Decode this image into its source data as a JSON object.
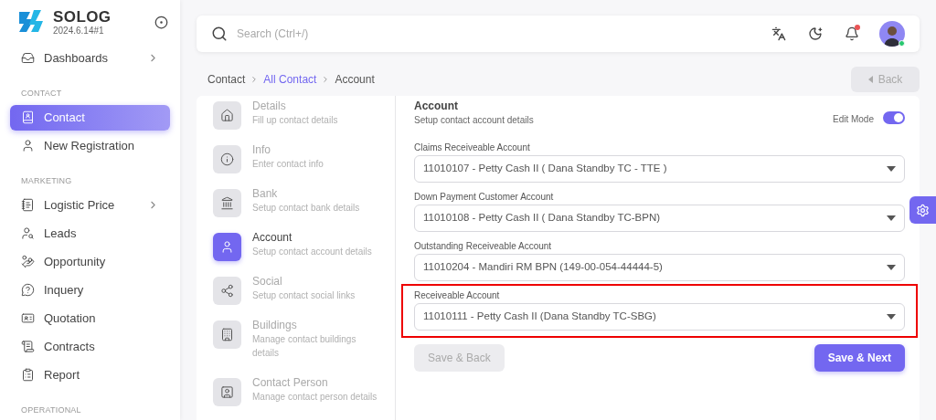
{
  "brand": {
    "name": "SOLOG",
    "version": "2024.6.14#1"
  },
  "sidebar": {
    "items": [
      {
        "kind": "item",
        "label": "Dashboards",
        "selected": false,
        "expandable": true
      },
      {
        "kind": "section",
        "label": "CONTACT"
      },
      {
        "kind": "item",
        "label": "Contact",
        "selected": true,
        "expandable": false
      },
      {
        "kind": "item",
        "label": "New Registration",
        "selected": false,
        "expandable": false
      },
      {
        "kind": "section",
        "label": "MARKETING"
      },
      {
        "kind": "item",
        "label": "Logistic Price",
        "selected": false,
        "expandable": true
      },
      {
        "kind": "item",
        "label": "Leads",
        "selected": false,
        "expandable": false
      },
      {
        "kind": "item",
        "label": "Opportunity",
        "selected": false,
        "expandable": false
      },
      {
        "kind": "item",
        "label": "Inquery",
        "selected": false,
        "expandable": false
      },
      {
        "kind": "item",
        "label": "Quotation",
        "selected": false,
        "expandable": false
      },
      {
        "kind": "item",
        "label": "Contracts",
        "selected": false,
        "expandable": false
      },
      {
        "kind": "item",
        "label": "Report",
        "selected": false,
        "expandable": false
      },
      {
        "kind": "section",
        "label": "OPERATIONAL"
      }
    ]
  },
  "search": {
    "placeholder": "Search (Ctrl+/)"
  },
  "breadcrumb": [
    {
      "label": "Contact",
      "link": false
    },
    {
      "label": "All Contact",
      "link": true
    },
    {
      "label": "Account",
      "link": false
    }
  ],
  "back_button": {
    "label": "Back",
    "disabled": true
  },
  "steps": [
    {
      "title": "Details",
      "subtitle": "Fill up contact details",
      "selected": false
    },
    {
      "title": "Info",
      "subtitle": "Enter contact info",
      "selected": false
    },
    {
      "title": "Bank",
      "subtitle": "Setup contact bank details",
      "selected": false
    },
    {
      "title": "Account",
      "subtitle": "Setup contact account details",
      "selected": true
    },
    {
      "title": "Social",
      "subtitle": "Setup contact social links",
      "selected": false
    },
    {
      "title": "Buildings",
      "subtitle": "Manage contact buildings details",
      "selected": false
    },
    {
      "title": "Contact Person",
      "subtitle": "Manage contact person details",
      "selected": false
    }
  ],
  "form": {
    "title": "Account",
    "subtitle": "Setup contact account details",
    "edit_mode": {
      "label": "Edit Mode",
      "on": true
    },
    "fields": [
      {
        "label": "Claims Receiveable Account",
        "value": "11010107 - Petty Cash II ( Dana Standby TC - TTE )",
        "highlighted": false
      },
      {
        "label": "Down Payment Customer Account",
        "value": "11010108 - Petty Cash II ( Dana Standby TC-BPN)",
        "highlighted": false
      },
      {
        "label": "Outstanding Receiveable Account",
        "value": "11010204 - Mandiri RM BPN (149-00-054-44444-5)",
        "highlighted": false
      },
      {
        "label": "Receiveable Account",
        "value": "11010111 - Petty Cash II (Dana Standby TC-SBG)",
        "highlighted": true
      }
    ],
    "buttons": [
      {
        "label": "Save & Back",
        "disabled": true
      },
      {
        "label": "Save & Next",
        "disabled": false
      }
    ]
  }
}
